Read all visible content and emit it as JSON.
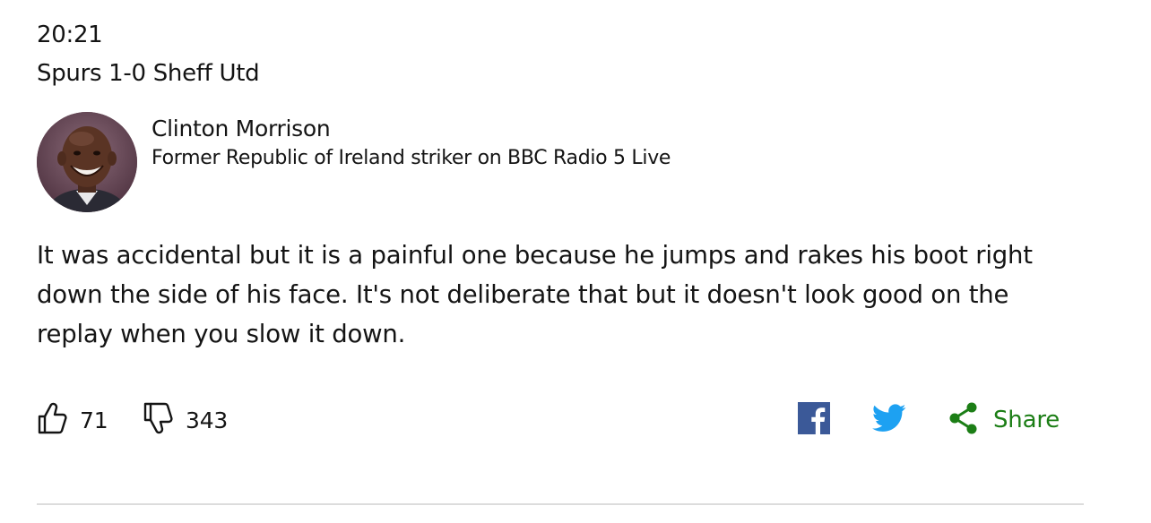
{
  "post": {
    "time": "20:21",
    "title": "Spurs 1-0 Sheff Utd",
    "contributor": {
      "name": "Clinton Morrison",
      "role": "Former Republic of Ireland striker on BBC Radio 5 Live",
      "avatar_icon": "person-photo"
    },
    "quote": "It was accidental but it is a painful one because he jumps and rakes his boot right down the side of his face. It's not deliberate that but it doesn't look good on the replay when you slow it down.",
    "votes": {
      "up_count": "71",
      "down_count": "343",
      "up_icon": "thumbs-up-icon",
      "down_icon": "thumbs-down-icon"
    },
    "social": {
      "facebook_icon": "facebook-icon",
      "twitter_icon": "twitter-icon",
      "share_icon": "share-icon",
      "share_label": "Share"
    }
  },
  "colors": {
    "text": "#141414",
    "facebook": "#3b5998",
    "twitter": "#1da1f2",
    "share": "#1c7e16",
    "divider": "#dcdcdc"
  }
}
